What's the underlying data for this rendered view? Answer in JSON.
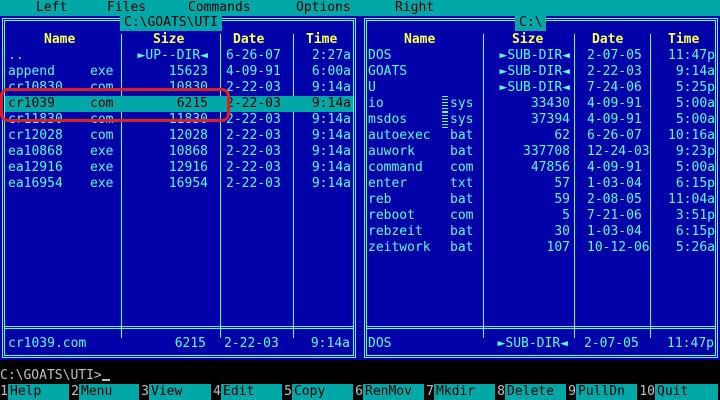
{
  "menu": [
    "Left",
    "Files",
    "Commands",
    "Options",
    "Right"
  ],
  "left_panel": {
    "title": "C:\\GOATS\\UTI",
    "headers": {
      "name": "Name",
      "size": "Size",
      "date": "Date",
      "time": "Time"
    },
    "rows": [
      {
        "name": "..",
        "ext": "",
        "size": "►UP--DIR◄",
        "date": "6-26-07",
        "time": "2:27a"
      },
      {
        "name": "append",
        "ext": "exe",
        "size": "15623",
        "date": "4-09-91",
        "time": "6:00a"
      },
      {
        "name": "cr10830",
        "ext": "com",
        "size": "10830",
        "date": "2-22-03",
        "time": "9:14a"
      },
      {
        "name": "cr1039",
        "ext": "com",
        "size": "6215",
        "date": "2-22-03",
        "time": "9:14a",
        "selected": true
      },
      {
        "name": "cr11830",
        "ext": "com",
        "size": "11830",
        "date": "2-22-03",
        "time": "9:14a"
      },
      {
        "name": "cr12028",
        "ext": "com",
        "size": "12028",
        "date": "2-22-03",
        "time": "9:14a"
      },
      {
        "name": "ea10868",
        "ext": "exe",
        "size": "10868",
        "date": "2-22-03",
        "time": "9:14a"
      },
      {
        "name": "ea12916",
        "ext": "exe",
        "size": "12916",
        "date": "2-22-03",
        "time": "9:14a"
      },
      {
        "name": "ea16954",
        "ext": "exe",
        "size": "16954",
        "date": "2-22-03",
        "time": "9:14a"
      }
    ],
    "status": {
      "name": "cr1039.com",
      "size": "6215",
      "date": "2-22-03",
      "time": "9:14a"
    }
  },
  "right_panel": {
    "title": "C:\\",
    "headers": {
      "name": "Name",
      "size": "Size",
      "date": "Date",
      "time": "Time"
    },
    "rows": [
      {
        "name": "DOS",
        "ext": "",
        "size": "►SUB-DIR◄",
        "date": "2-07-05",
        "time": "11:47p"
      },
      {
        "name": "GOATS",
        "ext": "",
        "size": "►SUB-DIR◄",
        "date": "2-22-03",
        "time": "9:14a"
      },
      {
        "name": "U",
        "ext": "",
        "size": "►SUB-DIR◄",
        "date": "7-24-06",
        "time": "5:25p"
      },
      {
        "name": "io",
        "ext": "sys",
        "size": "33430",
        "date": "4-09-91",
        "time": "5:00a",
        "marked": true
      },
      {
        "name": "msdos",
        "ext": "sys",
        "size": "37394",
        "date": "4-09-91",
        "time": "5:00a",
        "marked": true
      },
      {
        "name": "autoexec",
        "ext": "bat",
        "size": "62",
        "date": "6-26-07",
        "time": "10:16a"
      },
      {
        "name": "auwork",
        "ext": "bat",
        "size": "337708",
        "date": "12-24-03",
        "time": "9:23p"
      },
      {
        "name": "command",
        "ext": "com",
        "size": "47856",
        "date": "4-09-91",
        "time": "5:00a"
      },
      {
        "name": "enter",
        "ext": "txt",
        "size": "57",
        "date": "1-03-04",
        "time": "6:15p"
      },
      {
        "name": "reb",
        "ext": "bat",
        "size": "59",
        "date": "2-08-05",
        "time": "11:04a"
      },
      {
        "name": "reboot",
        "ext": "com",
        "size": "5",
        "date": "7-21-06",
        "time": "3:51p"
      },
      {
        "name": "rebzeit",
        "ext": "bat",
        "size": "30",
        "date": "1-03-04",
        "time": "6:15p"
      },
      {
        "name": "zeitwork",
        "ext": "bat",
        "size": "107",
        "date": "10-12-06",
        "time": "5:26a"
      }
    ],
    "status": {
      "name": "DOS",
      "size": "►SUB-DIR◄",
      "date": "2-07-05",
      "time": "11:47p"
    }
  },
  "command_line": "C:\\GOATS\\UTI>",
  "function_keys": [
    {
      "num": "1",
      "label": "Help"
    },
    {
      "num": "2",
      "label": "Menu"
    },
    {
      "num": "3",
      "label": "View"
    },
    {
      "num": "4",
      "label": "Edit"
    },
    {
      "num": "5",
      "label": "Copy"
    },
    {
      "num": "6",
      "label": "RenMov"
    },
    {
      "num": "7",
      "label": "Mkdir"
    },
    {
      "num": "8",
      "label": "Delete"
    },
    {
      "num": "9",
      "label": "PullDn"
    },
    {
      "num": "10",
      "label": "Quit"
    }
  ],
  "colors": {
    "panel_bg": "#0000a8",
    "text": "#55ffff",
    "header": "#ffff55",
    "selection_bg": "#00a8a8",
    "highlight_box": "#e02020"
  }
}
